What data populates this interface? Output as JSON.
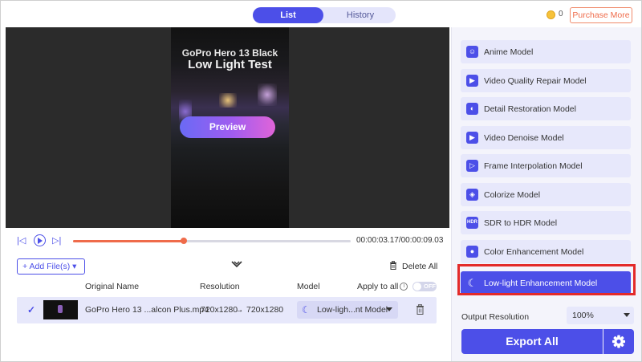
{
  "header": {
    "tabs": [
      {
        "label": "List",
        "active": true
      },
      {
        "label": "History",
        "active": false
      }
    ],
    "credits": "0",
    "purchase_label": "Purchase More"
  },
  "player": {
    "video_title_line1": "GoPro Hero 13 Black",
    "video_title_line2": "Low Light Test",
    "preview_label": "Preview",
    "progress_fraction": 0.4,
    "timecode": "00:00:03.17/00:00:09.03"
  },
  "file_toolbar": {
    "add_files_label": "+ Add File(s) ▾",
    "delete_all_label": "Delete All"
  },
  "table": {
    "columns": [
      "Original Name",
      "Resolution",
      "Model",
      "Apply to all"
    ],
    "apply_toggle_label": "OFF",
    "rows": [
      {
        "name": "GoPro Hero 13 ...alcon Plus.mp4",
        "resolution_from": "720x1280",
        "arrow": "→",
        "resolution_to": "720x1280",
        "model": "Low-ligh...nt Model"
      }
    ]
  },
  "models": {
    "items": [
      {
        "label": "Anime Model",
        "icon": "anime-icon",
        "glyph": "☺"
      },
      {
        "label": "Video Quality Repair Model",
        "icon": "video-repair-icon",
        "glyph": "▶"
      },
      {
        "label": "Detail Restoration Model",
        "icon": "detail-restore-icon",
        "glyph": "◐"
      },
      {
        "label": "Video Denoise Model",
        "icon": "denoise-icon",
        "glyph": "▶"
      },
      {
        "label": "Frame Interpolation Model",
        "icon": "frame-interp-icon",
        "glyph": "▷"
      },
      {
        "label": "Colorize Model",
        "icon": "colorize-icon",
        "glyph": "◈"
      },
      {
        "label": "SDR to HDR Model",
        "icon": "hdr-icon",
        "glyph": "HDR"
      },
      {
        "label": "Color Enhancement Model",
        "icon": "palette-icon",
        "glyph": "●"
      },
      {
        "label": "Low-light Enhancement Model",
        "icon": "moon-icon",
        "glyph": "☾",
        "selected": true
      }
    ]
  },
  "output": {
    "label": "Output Resolution",
    "value": "100%"
  },
  "export_label": "Export All",
  "colors": {
    "accent": "#4c4fe8",
    "progress": "#ef6b4a",
    "highlight": "#e32a2a"
  }
}
